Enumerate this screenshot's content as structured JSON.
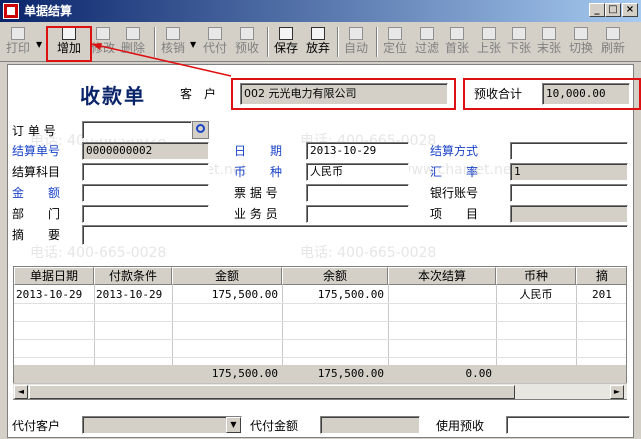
{
  "window": {
    "title": "单据结算"
  },
  "toolbar": {
    "items": [
      {
        "label": "打印",
        "enabled": false
      },
      {
        "label": "增加",
        "enabled": true
      },
      {
        "label": "修改",
        "enabled": false
      },
      {
        "label": "删除",
        "enabled": false
      },
      {
        "label": "核销",
        "enabled": false
      },
      {
        "label": "代付",
        "enabled": false
      },
      {
        "label": "预收",
        "enabled": false
      },
      {
        "label": "保存",
        "enabled": true
      },
      {
        "label": "放弃",
        "enabled": true
      },
      {
        "label": "自动",
        "enabled": false
      },
      {
        "label": "定位",
        "enabled": false
      },
      {
        "label": "过滤",
        "enabled": false
      },
      {
        "label": "首张",
        "enabled": false
      },
      {
        "label": "上张",
        "enabled": false
      },
      {
        "label": "下张",
        "enabled": false
      },
      {
        "label": "末张",
        "enabled": false
      },
      {
        "label": "切换",
        "enabled": false
      },
      {
        "label": "刷新",
        "enabled": false
      }
    ]
  },
  "header": {
    "doc_title": "收款单",
    "customer_label": "客　户",
    "customer_value": "002  元光电力有限公司",
    "prepaid_label": "预收合计",
    "prepaid_value": "10,000.00"
  },
  "form": {
    "order_no_label": "订 单 号",
    "order_no_value": "",
    "settle_no_label": "结算单号",
    "settle_no_value": "0000000002",
    "date_label": "日　　期",
    "date_value": "2013-10-29",
    "settle_method_label": "结算方式",
    "settle_method_value": "",
    "settle_subject_label": "结算科目",
    "settle_subject_value": "",
    "currency_label": "币　　种",
    "currency_value": "人民币",
    "rate_label": "汇　　率",
    "rate_value": "1",
    "amount_label": "金　　额",
    "amount_value": "",
    "bill_no_label": "票 据 号",
    "bill_no_value": "",
    "bank_account_label": "银行账号",
    "bank_account_value": "",
    "dept_label": "部　　门",
    "dept_value": "",
    "salesman_label": "业 务 员",
    "salesman_value": "",
    "project_label": "项　　目",
    "project_value": "",
    "summary_label": "摘　　要",
    "summary_value": ""
  },
  "grid": {
    "columns": [
      "单据日期",
      "付款条件",
      "金额",
      "余额",
      "本次结算",
      "币种",
      "摘"
    ],
    "rows": [
      [
        "2013-10-29",
        "2013-10-29",
        "175,500.00",
        "175,500.00",
        "",
        "人民币",
        "201"
      ]
    ],
    "totals": [
      "",
      "",
      "175,500.00",
      "175,500.00",
      "0.00",
      "",
      ""
    ]
  },
  "footer": {
    "agent_customer_label": "代付客户",
    "agent_customer_value": "",
    "agent_amount_label": "代付金额",
    "agent_amount_value": "",
    "use_prepaid_label": "使用预收",
    "use_prepaid_value": ""
  },
  "watermark": {
    "phone": "电话: 400-665-0028",
    "site": "www.chanjet.net",
    "site_label": "网址:"
  },
  "colors": {
    "highlight": "#d11111",
    "title_blue": "#0a246a",
    "label_blue": "#1a44c8"
  }
}
